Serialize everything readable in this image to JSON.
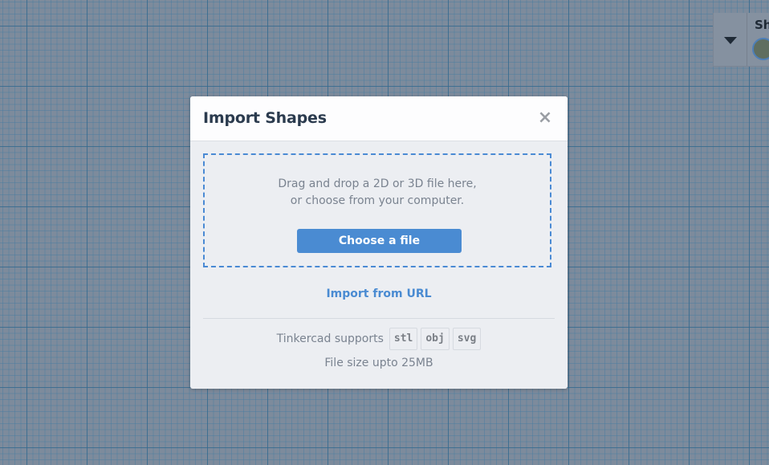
{
  "workspace": {
    "grid": "workplane-grid"
  },
  "shape_panel": {
    "title": "Sh",
    "toggle_icon": "caret-down-icon",
    "swatch_color": "#5f6e60"
  },
  "dialog": {
    "title": "Import Shapes",
    "close_icon": "close-icon",
    "close_glyph": "×",
    "dropzone": {
      "line1": "Drag and drop a 2D or 3D file here,",
      "line2": "or choose from your computer.",
      "choose_button": "Choose a file"
    },
    "import_url_link": "Import from URL",
    "supports_label": "Tinkercad supports",
    "formats": [
      "stl",
      "obj",
      "svg"
    ],
    "file_size_note": "File size upto 25MB"
  },
  "colors": {
    "accent": "#4a8bd2",
    "title": "#2b3b4e",
    "muted_text": "#7a8390",
    "dialog_body": "#eceef2",
    "canvas": "#7d8b9c"
  }
}
